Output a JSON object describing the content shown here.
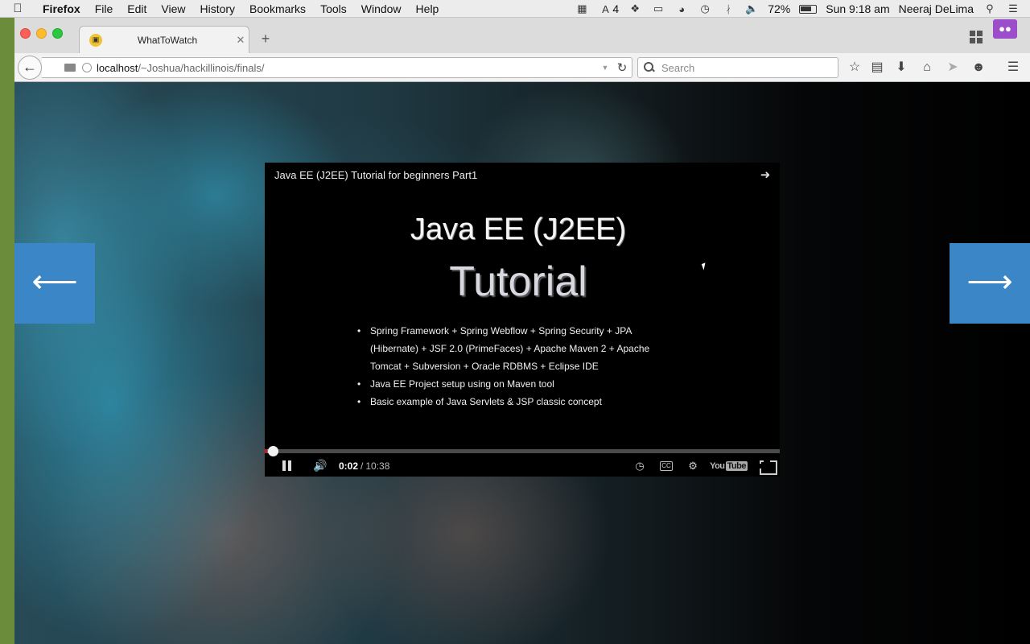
{
  "menubar": {
    "app_name": "Firefox",
    "items": [
      "File",
      "Edit",
      "View",
      "History",
      "Bookmarks",
      "Tools",
      "Window",
      "Help"
    ],
    "status_number": "4",
    "battery": "72%",
    "clock": "Sun 9:18 am",
    "user": "Neeraj DeLima"
  },
  "browser": {
    "tab_title": "WhatToWatch",
    "url_host": "localhost",
    "url_path": "/~Joshua/hackillinois/finals/",
    "search_placeholder": "Search"
  },
  "page": {
    "prev_arrow": "⟵",
    "next_arrow": "⟶"
  },
  "player": {
    "title": "Java EE (J2EE) Tutorial for beginners Part1",
    "slide_heading": "Java EE (J2EE)",
    "slide_subheading": "Tutorial",
    "slide_bullets": [
      "Spring Framework + Spring Webflow + Spring Security + JPA (Hibernate) + JSF 2.0 (PrimeFaces) + Apache Maven 2 + Apache Tomcat + Subversion + Oracle RDBMS + Eclipse IDE",
      "Java EE Project setup using on Maven tool",
      "Basic example of Java Servlets & JSP classic concept"
    ],
    "time_current": "0:02",
    "time_separator": "/",
    "time_total": "10:38",
    "cc_label": "CC",
    "logo_text": "You",
    "logo_tube": "Tube",
    "progress_fraction": 0.003,
    "loaded_fraction": 0.02
  },
  "colors": {
    "arrow_bg": "#3a86c6",
    "progress_red": "#cc181e"
  }
}
